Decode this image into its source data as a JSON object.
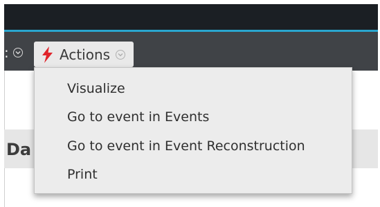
{
  "toolbar": {
    "prev_tab_fragment": ":",
    "actions_label": "Actions"
  },
  "panel": {
    "title_fragment": "Da"
  },
  "menu": {
    "items": [
      {
        "label": "Visualize"
      },
      {
        "label": "Go to event in Events"
      },
      {
        "label": "Go to event in Event Reconstruction"
      },
      {
        "label": "Print"
      }
    ]
  },
  "colors": {
    "topbar": "#1b1f24",
    "accent": "#2aa6cf",
    "toolbar": "#404347",
    "bolt": "#e0242b"
  },
  "icons": [
    "chevron-down-icon",
    "lightning-bolt-icon"
  ]
}
